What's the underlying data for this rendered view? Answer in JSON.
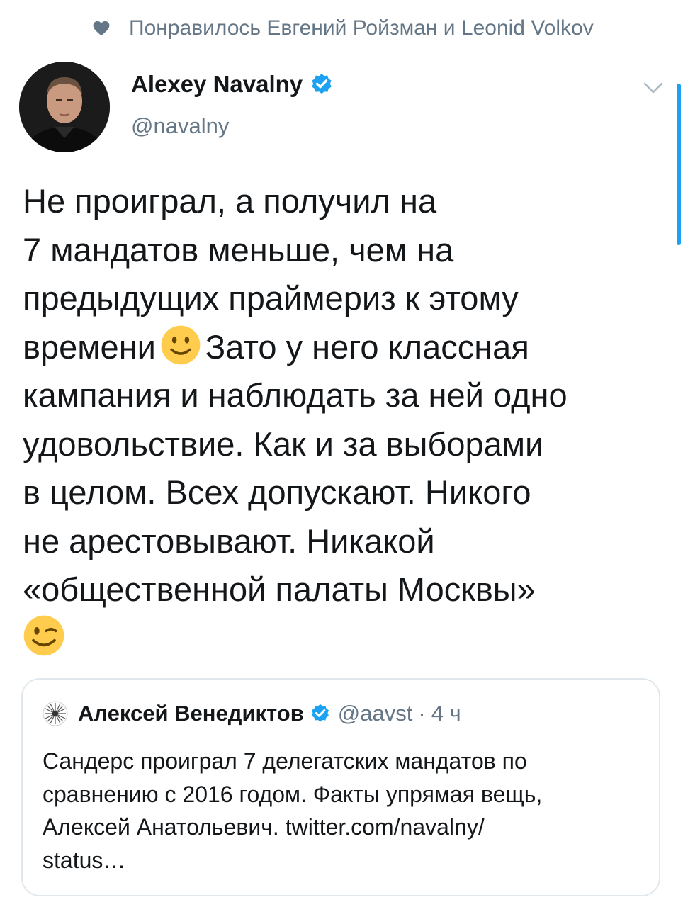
{
  "social_context": {
    "icon": "heart-icon",
    "text": "Понравилось Евгений Ройзман и Leonid Volkov"
  },
  "author": {
    "name": "Alexey Navalny",
    "handle": "@navalny",
    "verified": true
  },
  "tweet": {
    "lines": [
      "Не проиграл, а получил на",
      "7 мандатов меньше, чем на",
      "предыдущих праймериз к этому",
      "времени",
      "Зато у него классная",
      "кампания и наблюдать за ней одно",
      "удовольствие. Как и за выборами",
      "в целом. Всех допускают. Никого",
      "не арестовывают. Никакой",
      "«общественной палаты Москвы»"
    ],
    "emojis": [
      "slightly-smiling-face-icon",
      "winking-face-icon"
    ]
  },
  "quote": {
    "name": "Алексей Венедиктов",
    "verified": true,
    "handle": "@aavst",
    "separator": "·",
    "time": "4 ч",
    "lines": [
      "Сандерс проиграл 7 делегатских мандатов по",
      "сравнению с 2016 годом. Факты упрямая вещь,",
      "Алексей Анатольевич. twitter.com/navalny/",
      "status…"
    ]
  },
  "colors": {
    "accent": "#1da1f2",
    "secondary_text": "#657786",
    "border": "#e1e8ed",
    "emoji_yellow": "#ffcc4d"
  }
}
